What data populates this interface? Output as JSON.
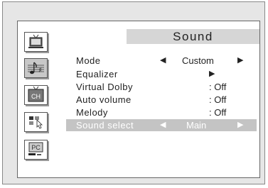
{
  "menu_title": "Sound",
  "items": [
    {
      "label": "Mode",
      "value": "Custom",
      "left_arrow": "◀",
      "right_arrow": "▶"
    },
    {
      "label": "Equalizer",
      "right_arrow": "▶"
    },
    {
      "label": "Virtual Dolby",
      "value": ": Off"
    },
    {
      "label": "Auto volume",
      "value": ": Off"
    },
    {
      "label": "Melody",
      "value": ": Off"
    },
    {
      "label": "Sound select",
      "value": "Main",
      "left_arrow": "◀",
      "right_arrow": "▶",
      "selected": true
    }
  ],
  "sidebar": [
    {
      "name": "picture-tv-icon"
    },
    {
      "name": "sound-note-icon",
      "active": true
    },
    {
      "name": "channel-icon",
      "label": "CH"
    },
    {
      "name": "setup-icon"
    },
    {
      "name": "pc-icon",
      "label": "PC"
    }
  ],
  "colors": {
    "selected_row": "#c4c4c4",
    "title_bar": "#d6d6d6",
    "active_icon": "#c8c8c8"
  }
}
